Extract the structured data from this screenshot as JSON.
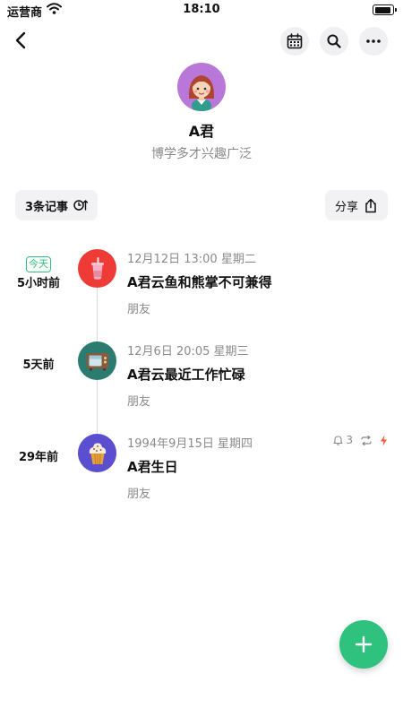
{
  "status_bar": {
    "carrier": "运营商",
    "time": "18:10",
    "battery_percent": 95
  },
  "profile": {
    "name": "A君",
    "bio": "博学多才兴趣广泛"
  },
  "toolbar": {
    "count_label": "3条记事",
    "share_label": "分享"
  },
  "icons": {
    "back": "chevron-left-icon",
    "calendar": "calendar-icon",
    "search": "search-icon",
    "more": "more-horizontal-icon",
    "sort": "clock-sort-icon",
    "share": "share-icon",
    "add": "plus-icon"
  },
  "colors": {
    "accent": "#2ec27e",
    "entry1": "#ef3b36",
    "entry2": "#2c7b70",
    "entry3": "#5b4fd0",
    "flash": "#f05a3a"
  },
  "entries": [
    {
      "badge": "今天",
      "relative": "5小时前",
      "datetime": "12月12日 13:00 星期二",
      "title": "A君云鱼和熊掌不可兼得",
      "tag": "朋友",
      "icon": "drink-cup-icon"
    },
    {
      "relative": "5天前",
      "datetime": "12月6日 20:05 星期三",
      "title": "A君云最近工作忙碌",
      "tag": "朋友",
      "icon": "tv-icon"
    },
    {
      "relative": "29年前",
      "datetime": "1994年9月15日 星期四",
      "title": "A君生日",
      "tag": "朋友",
      "icon": "cupcake-icon",
      "reminder_count": "3"
    }
  ]
}
